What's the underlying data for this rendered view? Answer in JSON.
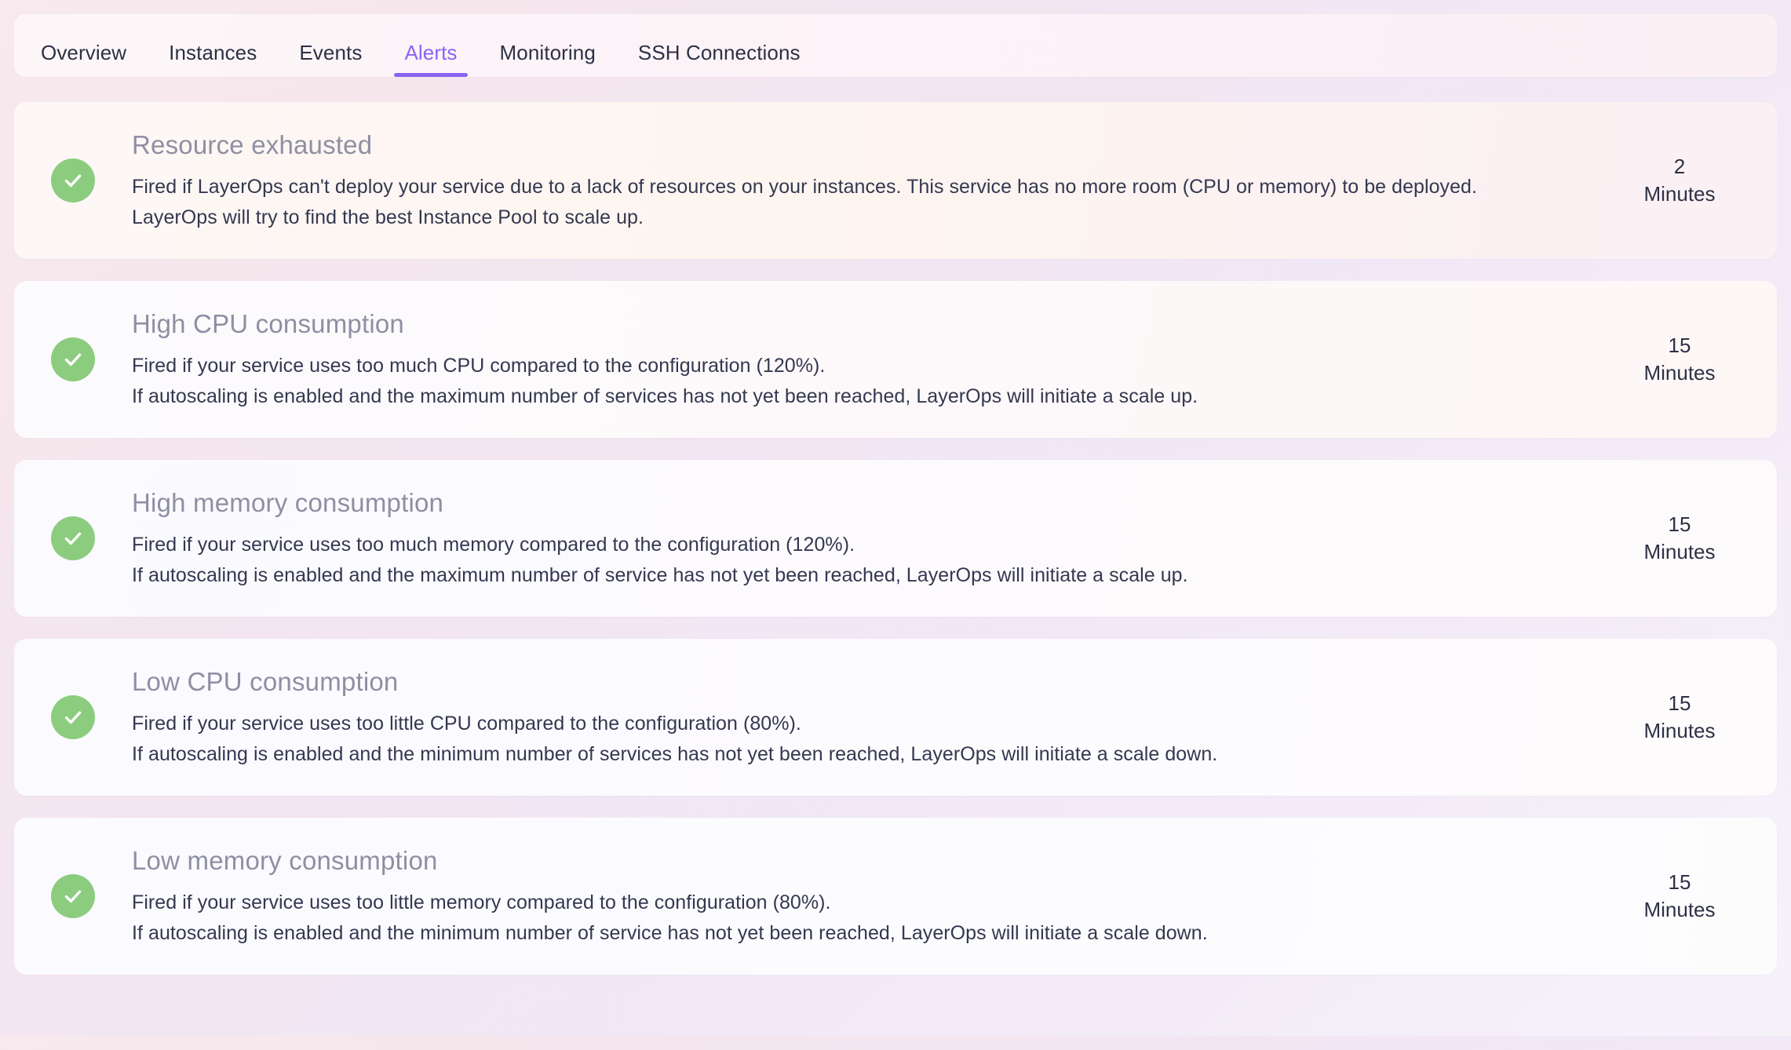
{
  "tabs": [
    {
      "label": "Overview",
      "active": false
    },
    {
      "label": "Instances",
      "active": false
    },
    {
      "label": "Events",
      "active": false
    },
    {
      "label": "Alerts",
      "active": true
    },
    {
      "label": "Monitoring",
      "active": false
    },
    {
      "label": "SSH Connections",
      "active": false
    }
  ],
  "colors": {
    "accent": "#8b63f3",
    "status_ok": "#8ccc7e",
    "title": "#8f8fa3",
    "body_text": "#343850",
    "page_background": "#f4ecf4"
  },
  "alerts": [
    {
      "status_icon": "check-circle-icon",
      "title": "Resource exhausted",
      "lines": [
        "Fired if LayerOps can't deploy your service due to a lack of resources on your instances. This service has no more room (CPU or memory) to be deployed.",
        "LayerOps will try to find the best Instance Pool to scale up."
      ],
      "interval_value": "2",
      "interval_unit": "Minutes"
    },
    {
      "status_icon": "check-circle-icon",
      "title": "High CPU consumption",
      "lines": [
        "Fired if your service uses too much CPU compared to the configuration (120%).",
        "If autoscaling is enabled and the maximum number of services has not yet been reached, LayerOps will initiate a scale up."
      ],
      "interval_value": "15",
      "interval_unit": "Minutes"
    },
    {
      "status_icon": "check-circle-icon",
      "title": "High memory consumption",
      "lines": [
        "Fired if your service uses too much memory compared to the configuration (120%).",
        "If autoscaling is enabled and the maximum number of service has not yet been reached, LayerOps will initiate a scale up."
      ],
      "interval_value": "15",
      "interval_unit": "Minutes"
    },
    {
      "status_icon": "check-circle-icon",
      "title": "Low CPU consumption",
      "lines": [
        "Fired if your service uses too little CPU compared to the configuration (80%).",
        "If autoscaling is enabled and the minimum number of services has not yet been reached, LayerOps will initiate a scale down."
      ],
      "interval_value": "15",
      "interval_unit": "Minutes"
    },
    {
      "status_icon": "check-circle-icon",
      "title": "Low memory consumption",
      "lines": [
        "Fired if your service uses too little memory compared to the configuration (80%).",
        "If autoscaling is enabled and the minimum number of service has not yet been reached, LayerOps will initiate a scale down."
      ],
      "interval_value": "15",
      "interval_unit": "Minutes"
    }
  ]
}
